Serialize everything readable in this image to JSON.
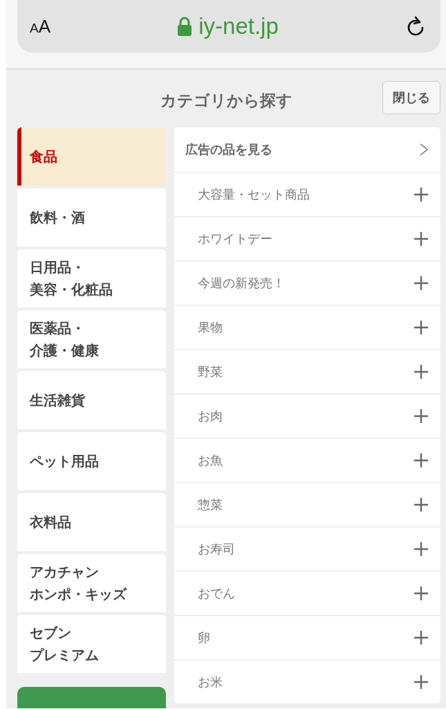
{
  "browser": {
    "text_size_button": "AA",
    "url": "iy-net.jp"
  },
  "header": {
    "title": "カテゴリから探す",
    "close_button": "閉じる"
  },
  "categories": [
    {
      "label": "食品",
      "selected": true
    },
    {
      "label": "飲料・酒",
      "selected": false
    },
    {
      "lines": [
        "日用品・",
        "美容・化粧品"
      ],
      "selected": false
    },
    {
      "lines": [
        "医薬品・",
        "介護・健康"
      ],
      "selected": false
    },
    {
      "label": "生活雑貨",
      "selected": false
    },
    {
      "label": "ペット用品",
      "selected": false
    },
    {
      "label": "衣料品",
      "selected": false
    },
    {
      "lines": [
        "アカチャン",
        "ホンポ・キッズ"
      ],
      "selected": false
    },
    {
      "lines": [
        "セブン",
        "プレミアム"
      ],
      "selected": false
    }
  ],
  "subcategories": [
    {
      "label": "広告の品を見る",
      "kind": "link"
    },
    {
      "label": "大容量・セット商品",
      "kind": "expand"
    },
    {
      "label": "ホワイトデー",
      "kind": "expand"
    },
    {
      "label": "今週の新発売！",
      "kind": "expand"
    },
    {
      "label": "果物",
      "kind": "expand"
    },
    {
      "label": "野菜",
      "kind": "expand"
    },
    {
      "label": "お肉",
      "kind": "expand"
    },
    {
      "label": "お魚",
      "kind": "expand"
    },
    {
      "label": "惣菜",
      "kind": "expand"
    },
    {
      "label": "お寿司",
      "kind": "expand"
    },
    {
      "label": "おでん",
      "kind": "expand"
    },
    {
      "label": "卵",
      "kind": "expand"
    },
    {
      "label": "お米",
      "kind": "expand"
    }
  ]
}
